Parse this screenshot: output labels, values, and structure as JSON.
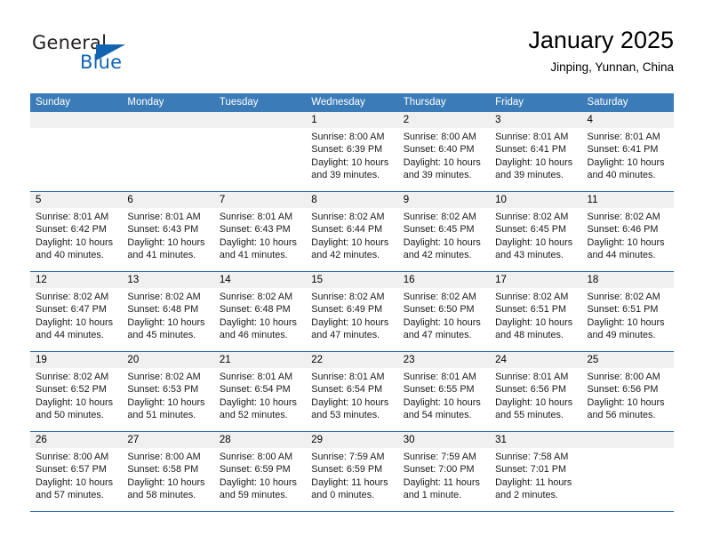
{
  "brand": {
    "name_part1": "General",
    "name_part2": "Blue",
    "logo_icon": "triangle-logo-icon"
  },
  "header": {
    "title": "January 2025",
    "subtitle": "Jinping, Yunnan, China"
  },
  "colors": {
    "header_blue": "#3b7cb8",
    "row_divider_blue": "#2d6ca8",
    "day_strip_gray": "#f0f0f0",
    "brand_blue": "#1263b0"
  },
  "weekdays": [
    "Sunday",
    "Monday",
    "Tuesday",
    "Wednesday",
    "Thursday",
    "Friday",
    "Saturday"
  ],
  "weeks": [
    [
      {
        "day": "",
        "empty": true,
        "sunrise": "",
        "sunset": "",
        "daylight": ""
      },
      {
        "day": "",
        "empty": true,
        "sunrise": "",
        "sunset": "",
        "daylight": ""
      },
      {
        "day": "",
        "empty": true,
        "sunrise": "",
        "sunset": "",
        "daylight": ""
      },
      {
        "day": "1",
        "empty": false,
        "sunrise": "Sunrise: 8:00 AM",
        "sunset": "Sunset: 6:39 PM",
        "daylight": "Daylight: 10 hours and 39 minutes."
      },
      {
        "day": "2",
        "empty": false,
        "sunrise": "Sunrise: 8:00 AM",
        "sunset": "Sunset: 6:40 PM",
        "daylight": "Daylight: 10 hours and 39 minutes."
      },
      {
        "day": "3",
        "empty": false,
        "sunrise": "Sunrise: 8:01 AM",
        "sunset": "Sunset: 6:41 PM",
        "daylight": "Daylight: 10 hours and 39 minutes."
      },
      {
        "day": "4",
        "empty": false,
        "sunrise": "Sunrise: 8:01 AM",
        "sunset": "Sunset: 6:41 PM",
        "daylight": "Daylight: 10 hours and 40 minutes."
      }
    ],
    [
      {
        "day": "5",
        "empty": false,
        "sunrise": "Sunrise: 8:01 AM",
        "sunset": "Sunset: 6:42 PM",
        "daylight": "Daylight: 10 hours and 40 minutes."
      },
      {
        "day": "6",
        "empty": false,
        "sunrise": "Sunrise: 8:01 AM",
        "sunset": "Sunset: 6:43 PM",
        "daylight": "Daylight: 10 hours and 41 minutes."
      },
      {
        "day": "7",
        "empty": false,
        "sunrise": "Sunrise: 8:01 AM",
        "sunset": "Sunset: 6:43 PM",
        "daylight": "Daylight: 10 hours and 41 minutes."
      },
      {
        "day": "8",
        "empty": false,
        "sunrise": "Sunrise: 8:02 AM",
        "sunset": "Sunset: 6:44 PM",
        "daylight": "Daylight: 10 hours and 42 minutes."
      },
      {
        "day": "9",
        "empty": false,
        "sunrise": "Sunrise: 8:02 AM",
        "sunset": "Sunset: 6:45 PM",
        "daylight": "Daylight: 10 hours and 42 minutes."
      },
      {
        "day": "10",
        "empty": false,
        "sunrise": "Sunrise: 8:02 AM",
        "sunset": "Sunset: 6:45 PM",
        "daylight": "Daylight: 10 hours and 43 minutes."
      },
      {
        "day": "11",
        "empty": false,
        "sunrise": "Sunrise: 8:02 AM",
        "sunset": "Sunset: 6:46 PM",
        "daylight": "Daylight: 10 hours and 44 minutes."
      }
    ],
    [
      {
        "day": "12",
        "empty": false,
        "sunrise": "Sunrise: 8:02 AM",
        "sunset": "Sunset: 6:47 PM",
        "daylight": "Daylight: 10 hours and 44 minutes."
      },
      {
        "day": "13",
        "empty": false,
        "sunrise": "Sunrise: 8:02 AM",
        "sunset": "Sunset: 6:48 PM",
        "daylight": "Daylight: 10 hours and 45 minutes."
      },
      {
        "day": "14",
        "empty": false,
        "sunrise": "Sunrise: 8:02 AM",
        "sunset": "Sunset: 6:48 PM",
        "daylight": "Daylight: 10 hours and 46 minutes."
      },
      {
        "day": "15",
        "empty": false,
        "sunrise": "Sunrise: 8:02 AM",
        "sunset": "Sunset: 6:49 PM",
        "daylight": "Daylight: 10 hours and 47 minutes."
      },
      {
        "day": "16",
        "empty": false,
        "sunrise": "Sunrise: 8:02 AM",
        "sunset": "Sunset: 6:50 PM",
        "daylight": "Daylight: 10 hours and 47 minutes."
      },
      {
        "day": "17",
        "empty": false,
        "sunrise": "Sunrise: 8:02 AM",
        "sunset": "Sunset: 6:51 PM",
        "daylight": "Daylight: 10 hours and 48 minutes."
      },
      {
        "day": "18",
        "empty": false,
        "sunrise": "Sunrise: 8:02 AM",
        "sunset": "Sunset: 6:51 PM",
        "daylight": "Daylight: 10 hours and 49 minutes."
      }
    ],
    [
      {
        "day": "19",
        "empty": false,
        "sunrise": "Sunrise: 8:02 AM",
        "sunset": "Sunset: 6:52 PM",
        "daylight": "Daylight: 10 hours and 50 minutes."
      },
      {
        "day": "20",
        "empty": false,
        "sunrise": "Sunrise: 8:02 AM",
        "sunset": "Sunset: 6:53 PM",
        "daylight": "Daylight: 10 hours and 51 minutes."
      },
      {
        "day": "21",
        "empty": false,
        "sunrise": "Sunrise: 8:01 AM",
        "sunset": "Sunset: 6:54 PM",
        "daylight": "Daylight: 10 hours and 52 minutes."
      },
      {
        "day": "22",
        "empty": false,
        "sunrise": "Sunrise: 8:01 AM",
        "sunset": "Sunset: 6:54 PM",
        "daylight": "Daylight: 10 hours and 53 minutes."
      },
      {
        "day": "23",
        "empty": false,
        "sunrise": "Sunrise: 8:01 AM",
        "sunset": "Sunset: 6:55 PM",
        "daylight": "Daylight: 10 hours and 54 minutes."
      },
      {
        "day": "24",
        "empty": false,
        "sunrise": "Sunrise: 8:01 AM",
        "sunset": "Sunset: 6:56 PM",
        "daylight": "Daylight: 10 hours and 55 minutes."
      },
      {
        "day": "25",
        "empty": false,
        "sunrise": "Sunrise: 8:00 AM",
        "sunset": "Sunset: 6:56 PM",
        "daylight": "Daylight: 10 hours and 56 minutes."
      }
    ],
    [
      {
        "day": "26",
        "empty": false,
        "sunrise": "Sunrise: 8:00 AM",
        "sunset": "Sunset: 6:57 PM",
        "daylight": "Daylight: 10 hours and 57 minutes."
      },
      {
        "day": "27",
        "empty": false,
        "sunrise": "Sunrise: 8:00 AM",
        "sunset": "Sunset: 6:58 PM",
        "daylight": "Daylight: 10 hours and 58 minutes."
      },
      {
        "day": "28",
        "empty": false,
        "sunrise": "Sunrise: 8:00 AM",
        "sunset": "Sunset: 6:59 PM",
        "daylight": "Daylight: 10 hours and 59 minutes."
      },
      {
        "day": "29",
        "empty": false,
        "sunrise": "Sunrise: 7:59 AM",
        "sunset": "Sunset: 6:59 PM",
        "daylight": "Daylight: 11 hours and 0 minutes."
      },
      {
        "day": "30",
        "empty": false,
        "sunrise": "Sunrise: 7:59 AM",
        "sunset": "Sunset: 7:00 PM",
        "daylight": "Daylight: 11 hours and 1 minute."
      },
      {
        "day": "31",
        "empty": false,
        "sunrise": "Sunrise: 7:58 AM",
        "sunset": "Sunset: 7:01 PM",
        "daylight": "Daylight: 11 hours and 2 minutes."
      },
      {
        "day": "",
        "empty": true,
        "sunrise": "",
        "sunset": "",
        "daylight": ""
      }
    ]
  ]
}
